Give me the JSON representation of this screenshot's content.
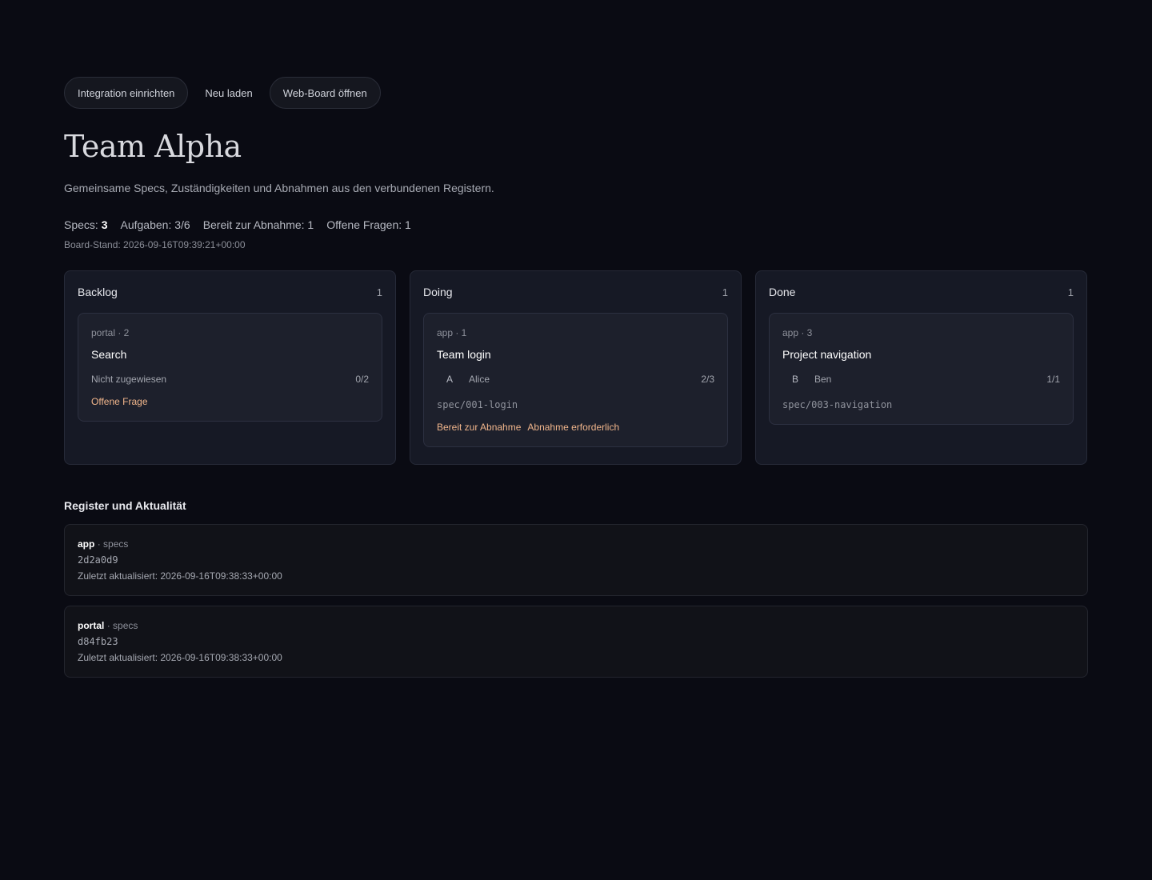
{
  "toolbar": {
    "setup_label": "Integration einrichten",
    "reload_label": "Neu laden",
    "open_board_label": "Web-Board öffnen"
  },
  "header": {
    "title": "Team Alpha",
    "subtitle": "Gemeinsame Specs, Zuständigkeiten und Abnahmen aus den verbundenen Registern."
  },
  "stats": {
    "specs_label": "Specs:",
    "specs_value": "3",
    "tasks": "Aufgaben: 3/6",
    "ready": "Bereit zur Abnahme: 1",
    "questions": "Offene Fragen: 1",
    "board_stand": "Board-Stand: 2026-09-16T09:39:21+00:00"
  },
  "columns": [
    {
      "title": "Backlog",
      "count": "1",
      "card": {
        "meta": "portal · 2",
        "title": "Search",
        "assignee": "Nicht zugewiesen",
        "progress": "0/2",
        "tag": "Offene Frage"
      }
    },
    {
      "title": "Doing",
      "count": "1",
      "card": {
        "meta": "app · 1",
        "title": "Team login",
        "avatar": "A",
        "assignee": "Alice",
        "progress": "2/3",
        "branch": "spec/001-login",
        "tag1": "Bereit zur Abnahme",
        "tag2": "Abnahme erforderlich"
      }
    },
    {
      "title": "Done",
      "count": "1",
      "card": {
        "meta": "app · 3",
        "title": "Project navigation",
        "avatar": "B",
        "assignee": "Ben",
        "progress": "1/1",
        "branch": "spec/003-navigation"
      }
    }
  ],
  "registers": {
    "title": "Register und Aktualität",
    "items": [
      {
        "name": "app",
        "kind": "· specs",
        "hash": "2d2a0d9",
        "updated": "Zuletzt aktualisiert: 2026-09-16T09:38:33+00:00"
      },
      {
        "name": "portal",
        "kind": "· specs",
        "hash": "d84fb23",
        "updated": "Zuletzt aktualisiert: 2026-09-16T09:38:33+00:00"
      }
    ]
  },
  "colors": {
    "background": "#0a0b13",
    "column_bg": "#161925",
    "card_bg": "#1d202c",
    "accent_tag": "#f0b58b"
  }
}
